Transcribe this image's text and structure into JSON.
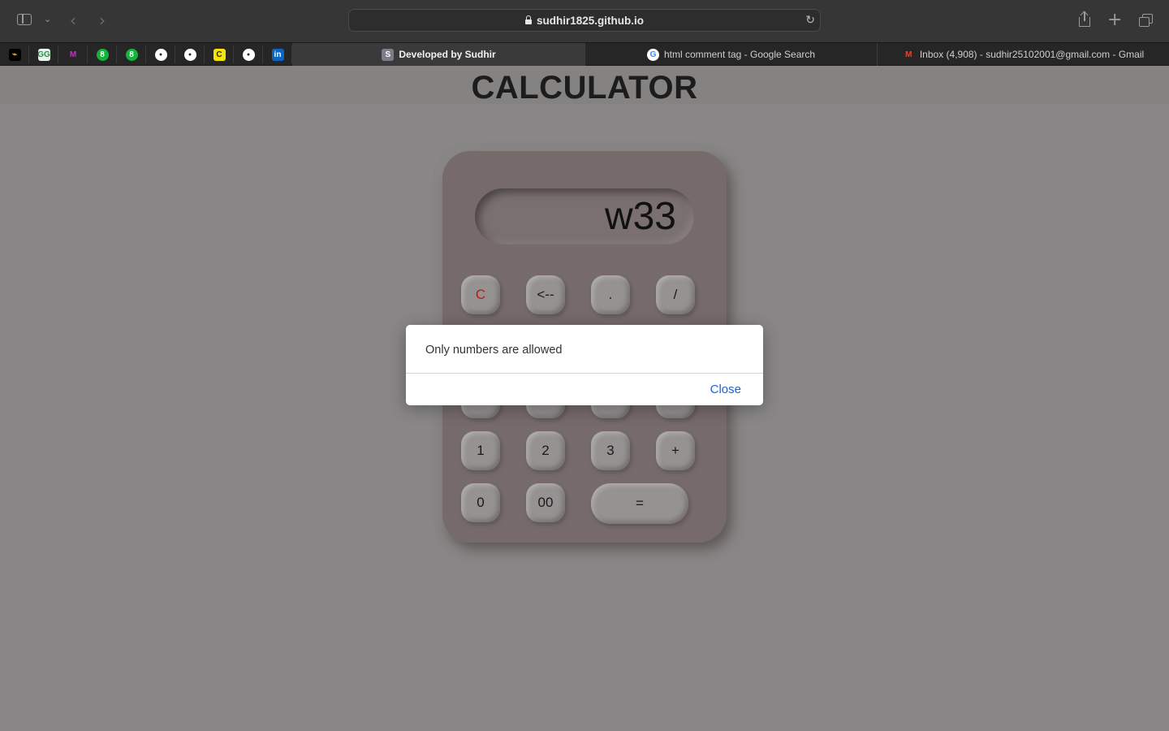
{
  "browser": {
    "url": "sudhir1825.github.io",
    "pinned_tabs": [
      {
        "name": "pinned-tab-1",
        "icon": "swift-icon",
        "glyph": "⌁",
        "bg": "#000000",
        "fg": "#f5a623"
      },
      {
        "name": "pinned-tab-2",
        "icon": "geeksforgeeks-icon",
        "glyph": "GG",
        "bg": "#e8f5ec",
        "fg": "#2f8d46"
      },
      {
        "name": "pinned-tab-3",
        "icon": "m-logo-icon",
        "glyph": "M",
        "bg": "#262626",
        "fg": "#c72bd6"
      },
      {
        "name": "pinned-tab-4",
        "icon": "green-circle-icon",
        "glyph": "8",
        "bg": "#12b53a",
        "fg": "#ffffff"
      },
      {
        "name": "pinned-tab-5",
        "icon": "green-circle-icon",
        "glyph": "8",
        "bg": "#12b53a",
        "fg": "#ffffff"
      },
      {
        "name": "pinned-tab-6",
        "icon": "github-icon",
        "glyph": "●",
        "bg": "#262626",
        "fg": "#ffffff"
      },
      {
        "name": "pinned-tab-7",
        "icon": "github-icon",
        "glyph": "●",
        "bg": "#262626",
        "fg": "#ffffff"
      },
      {
        "name": "pinned-tab-8",
        "icon": "yellow-c-icon",
        "glyph": "C",
        "bg": "#f5e400",
        "fg": "#222222"
      },
      {
        "name": "pinned-tab-9",
        "icon": "github-icon",
        "glyph": "●",
        "bg": "#262626",
        "fg": "#ffffff"
      },
      {
        "name": "pinned-tab-10",
        "icon": "linkedin-icon",
        "glyph": "in",
        "bg": "#0a66c2",
        "fg": "#ffffff"
      }
    ],
    "tabs": [
      {
        "label": "Developed by Sudhir",
        "icon_glyph": "S",
        "icon": "s-favicon-icon",
        "active": true
      },
      {
        "label": "html comment tag - Google Search",
        "icon_glyph": "G",
        "icon": "google-icon",
        "active": false
      },
      {
        "label": "Inbox (4,908) - sudhir25102001@gmail.com - Gmail",
        "icon_glyph": "M",
        "icon": "gmail-icon",
        "active": false
      }
    ]
  },
  "page": {
    "title": "CALCULATOR",
    "display_value": "w33",
    "keys": {
      "clear": "C",
      "backspace": "<--",
      "dot": ".",
      "divide": "/",
      "one": "1",
      "two": "2",
      "three": "3",
      "plus": "+",
      "zero": "0",
      "double_zero": "00",
      "equals": "="
    }
  },
  "alert": {
    "message": "Only numbers are allowed",
    "close_label": "Close"
  },
  "colors": {
    "page_bg": "#888686",
    "calculator_body": "#766a6a",
    "clear_key_text": "#c01818",
    "link_blue": "#1a63d6"
  }
}
